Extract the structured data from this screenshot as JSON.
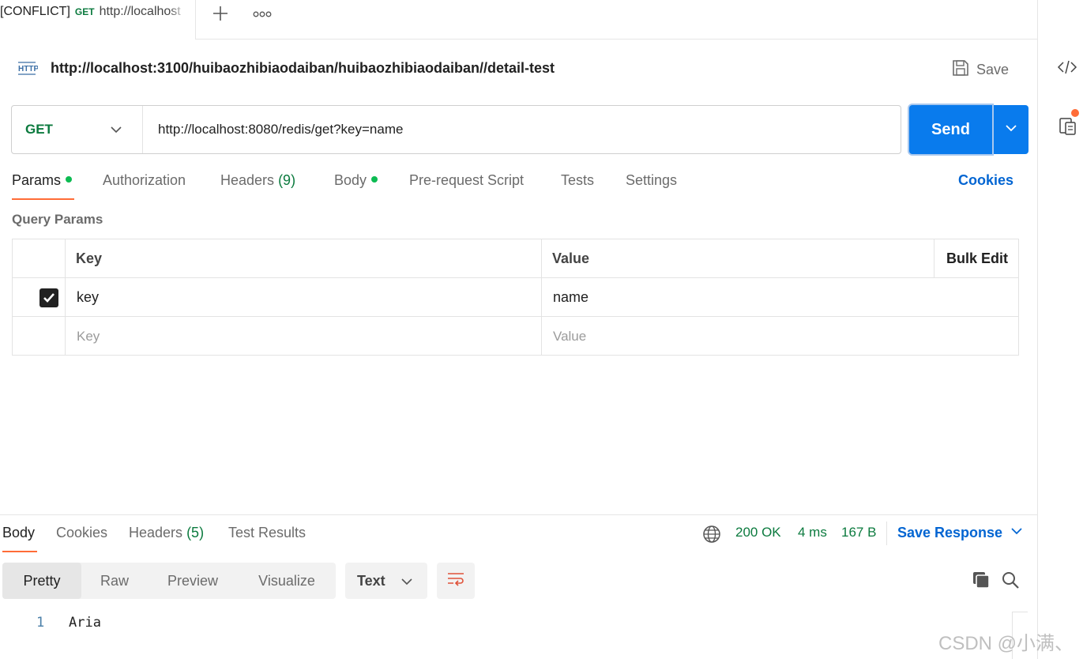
{
  "tabstrip": {
    "tab_conflict": "[CONFLICT]",
    "tab_method": "GET",
    "tab_title": "http://localhost",
    "add_icon": "plus-icon",
    "more_icon": "more-options-icon"
  },
  "request": {
    "name": "http://localhost:3100/huibaozhibiaodaiban/huibaozhibiaodaiban//detail-test",
    "save_label": "Save",
    "method": "GET",
    "url": "http://localhost:8080/redis/get?key=name",
    "send_label": "Send"
  },
  "request_tabs": {
    "params": "Params",
    "authorization": "Authorization",
    "headers": "Headers",
    "headers_count": "(9)",
    "body": "Body",
    "pre_request": "Pre-request Script",
    "tests": "Tests",
    "settings": "Settings",
    "cookies": "Cookies"
  },
  "query_params": {
    "title": "Query Params",
    "columns": {
      "key": "Key",
      "value": "Value",
      "bulk_edit": "Bulk Edit"
    },
    "rows": [
      {
        "checked": true,
        "key": "key",
        "value": "name"
      }
    ],
    "placeholder": {
      "key": "Key",
      "value": "Value"
    }
  },
  "response": {
    "tabs": {
      "body": "Body",
      "cookies": "Cookies",
      "headers": "Headers",
      "headers_count": "(5)",
      "test_results": "Test Results"
    },
    "status": "200 OK",
    "time": "4 ms",
    "size": "167 B",
    "save_response": "Save Response",
    "views": [
      "Pretty",
      "Raw",
      "Preview",
      "Visualize"
    ],
    "format": "Text",
    "lines": [
      {
        "num": "1",
        "text": "Aria"
      }
    ]
  },
  "watermark": "CSDN @小满、",
  "colors": {
    "accent": "#ff6c37",
    "send": "#097bed",
    "link": "#0265d2",
    "method_get": "#0b7a3e",
    "dot_green": "#0cbb52"
  }
}
